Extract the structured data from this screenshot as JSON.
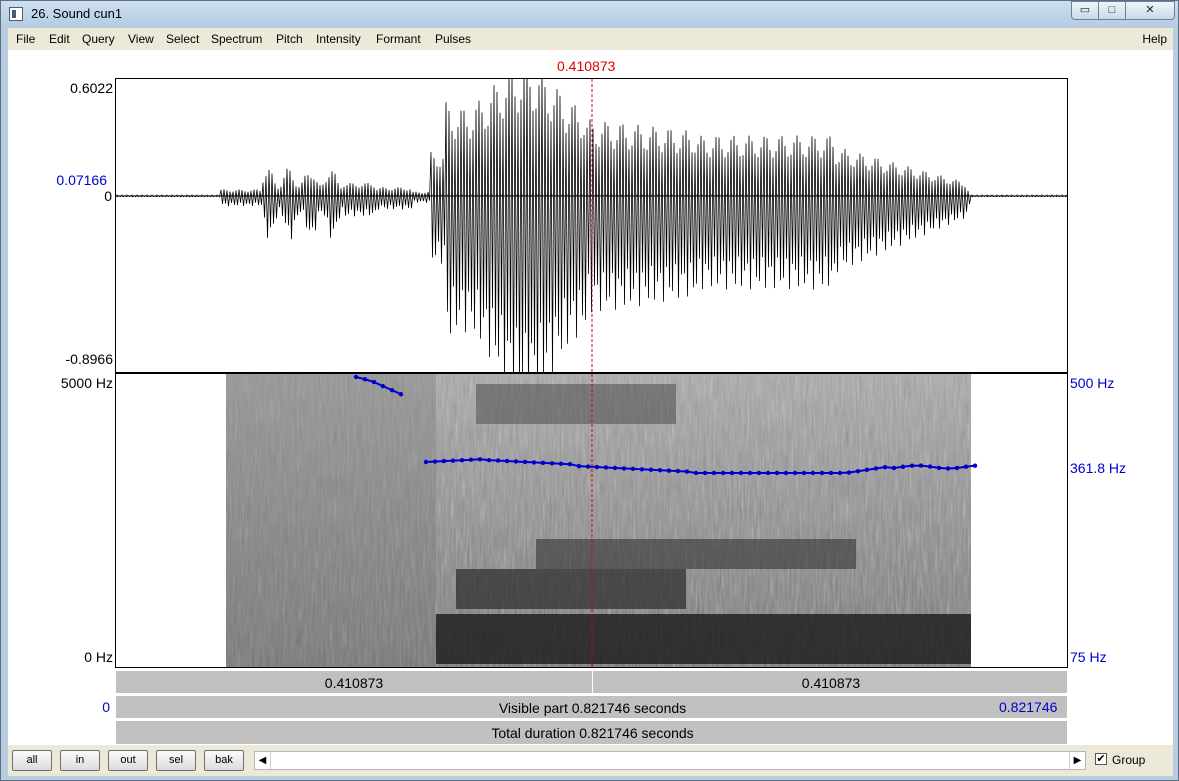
{
  "window": {
    "title": "26. Sound cun1",
    "min": "▭",
    "max": "□",
    "close": "✕"
  },
  "menu": {
    "items": [
      "File",
      "Edit",
      "Query",
      "View",
      "Select",
      "Spectrum",
      "Pitch",
      "Intensity",
      "Formant",
      "Pulses"
    ],
    "help": "Help"
  },
  "cursor": {
    "time_label": "0.410873",
    "color": "#e00000"
  },
  "waveform": {
    "max_label": "0.6022",
    "cursor_value_label": "0.07166",
    "zero_label": "0",
    "min_label": "-0.8966"
  },
  "spectrogram": {
    "top_freq": "5000 Hz",
    "bottom_freq": "0 Hz"
  },
  "pitch": {
    "top": "500 Hz",
    "current": "361.8 Hz",
    "bottom": "75 Hz",
    "color": "#0000cc"
  },
  "time_rows": {
    "left_of_cursor": "0.410873",
    "right_of_cursor": "0.410873",
    "visible_start": "0",
    "visible_text": "Visible part 0.821746 seconds",
    "visible_end": "0.821746",
    "total_text": "Total duration 0.821746 seconds"
  },
  "bottom": {
    "buttons": [
      "all",
      "in",
      "out",
      "sel",
      "bak"
    ],
    "scroll_left": "◀",
    "scroll_right": "▶",
    "group_label": "Group",
    "group_checked": "✔"
  }
}
